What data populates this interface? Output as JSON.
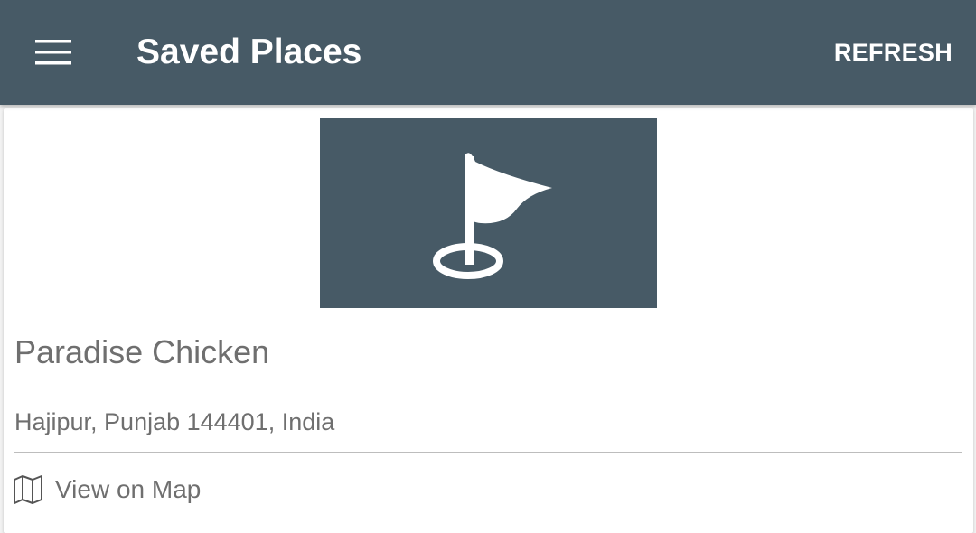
{
  "header": {
    "title": "Saved Places",
    "refresh_label": "REFRESH",
    "menu_icon": "hamburger-menu-icon",
    "background_color": "#475a66"
  },
  "place": {
    "image_icon": "flag-pin-icon",
    "name": "Paradise Chicken",
    "address": "Hajipur, Punjab 144401, India",
    "map_link_icon": "map-icon",
    "map_link_label": "View on Map"
  },
  "colors": {
    "accent": "#475a66",
    "text_secondary": "#6f6f6f",
    "divider": "#bdbdbd"
  }
}
